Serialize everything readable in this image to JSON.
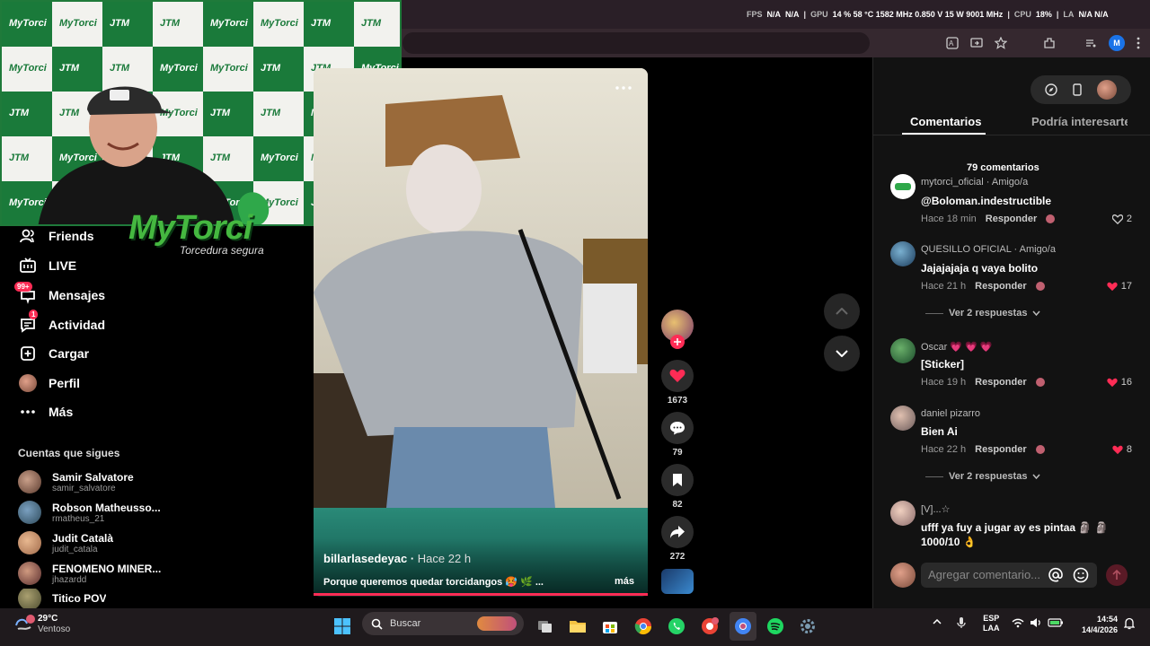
{
  "os_overlay": {
    "fps_label": "FPS",
    "fps_value": "N/A",
    "fps_value2": "N/A",
    "gpu_label": "GPU",
    "gpu_values": "14 % 58 °C 1582 MHz 0.850 V 15 W 9001 MHz",
    "cpu_label": "CPU",
    "cpu_value": "18%",
    "la_label": "LA",
    "la_values": "N/A N/A"
  },
  "browser": {
    "profile_initial": "M"
  },
  "webcam": {
    "brand": "MyTorci",
    "slogan": "Torcedura segura",
    "checker_logo_a": "MyTorci",
    "checker_logo_b": "JTM"
  },
  "sidebar": {
    "items": [
      {
        "label": "Friends",
        "icon": "friends-icon"
      },
      {
        "label": "LIVE",
        "icon": "live-icon"
      },
      {
        "label": "Mensajes",
        "icon": "messages-icon",
        "badge": "99+"
      },
      {
        "label": "Actividad",
        "icon": "activity-icon",
        "badge": "1"
      },
      {
        "label": "Cargar",
        "icon": "upload-icon"
      },
      {
        "label": "Perfil",
        "icon": "profile-avatar"
      },
      {
        "label": "Más",
        "icon": "more-icon"
      }
    ],
    "following_title": "Cuentas que sigues",
    "accounts": [
      {
        "name": "Samir Salvatore",
        "handle": "samir_salvatore"
      },
      {
        "name": "Robson Matheusso...",
        "handle": "rmatheus_21"
      },
      {
        "name": "Judit Català",
        "handle": "judit_catala"
      },
      {
        "name": "FENOMENO MINER...",
        "handle": "jhazardd"
      },
      {
        "name": "Titico POV",
        "handle": ""
      }
    ]
  },
  "video": {
    "author": "billarlasedeyac",
    "time": "Hace 22 h",
    "caption": "Porque queremos quedar torcidangos 🥵 🌿 ...",
    "more": "más",
    "likes": "1673",
    "comments": "79",
    "saves": "82",
    "shares": "272"
  },
  "panel": {
    "tabs": [
      "Comentarios",
      "Podría interesarte"
    ],
    "comment_count": "79 comentarios",
    "comments": [
      {
        "user": "mytorci_oficial · Amigo/a",
        "text": "@Boloman.indestructible",
        "time": "Hace 18 min",
        "reply": "Responder",
        "likes": "2",
        "liked": false
      },
      {
        "user": "QUESILLO OFICIAL · Amigo/a",
        "text": "Jajajajaja q vaya bolito",
        "time": "Hace 21 h",
        "reply": "Responder",
        "likes": "17",
        "liked": true,
        "replies": "Ver 2 respuestas"
      },
      {
        "user": "Oscar 💗 💗 💗",
        "text": "[Sticker]",
        "time": "Hace 19 h",
        "reply": "Responder",
        "likes": "16",
        "liked": true
      },
      {
        "user": "daniel pizarro",
        "text": "Bien Ai",
        "time": "Hace 22 h",
        "reply": "Responder",
        "likes": "8",
        "liked": true,
        "replies": "Ver 2 respuestas"
      },
      {
        "user": "[V]...☆",
        "text": "ufff ya fuy a jugar ay es pintaa 🗿 🗿",
        "text2": "1000/10 👌",
        "time": "",
        "reply": "",
        "likes": "",
        "liked": false
      }
    ],
    "input_placeholder": "Agregar comentario..."
  },
  "taskbar": {
    "weather_temp": "29°C",
    "weather_desc": "Ventoso",
    "search_label": "Buscar",
    "lang_1": "ESP",
    "lang_2": "LAA",
    "time": "14:54",
    "date": "14/4/2026"
  }
}
